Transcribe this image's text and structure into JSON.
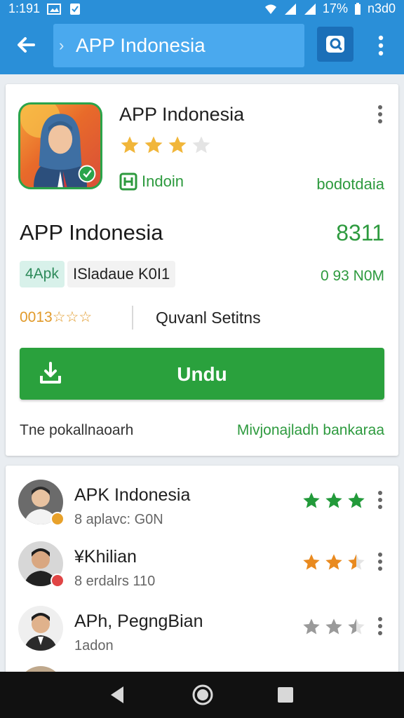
{
  "status_bar": {
    "time": "1:191",
    "battery_text": "17%",
    "clock_right": "n3d0"
  },
  "search": {
    "query": "APP Indonesia"
  },
  "header": {
    "title": "APP Indonesia",
    "rating_stars": 3,
    "badge_label": "Indoin",
    "right_link": "bodotdaia"
  },
  "app": {
    "name": "APP Indonesia",
    "number": "8311",
    "apk_chip": "4Apk",
    "status_chip": "ISladaue K0I1",
    "size": "0 93 N0M",
    "rating_text": "0013☆☆☆",
    "quick_link": "Quvanl Setitns",
    "download_label": "Undu",
    "footer_left": "Tne pokallnaoarh",
    "footer_right": "Mivjonajladh bankaraa"
  },
  "list": {
    "items": [
      {
        "title": "APK Indonesia",
        "subtitle": "8 aplavc: G0N",
        "stars": 3,
        "star_color": "#229a3a",
        "badge_color": "#e8a12a"
      },
      {
        "title": "¥Khilian",
        "subtitle": "8 erdalrs 110",
        "stars": 2.5,
        "star_color": "#e98a1f",
        "badge_color": "#e04545"
      },
      {
        "title": "APh, PegngBian",
        "subtitle": "1adon",
        "stars": 2.5,
        "star_color": "#9a9a9a",
        "badge_color": ""
      }
    ]
  },
  "colors": {
    "accent": "#2a8fd8",
    "green": "#2aa13d",
    "star_gold": "#f1b63a"
  }
}
